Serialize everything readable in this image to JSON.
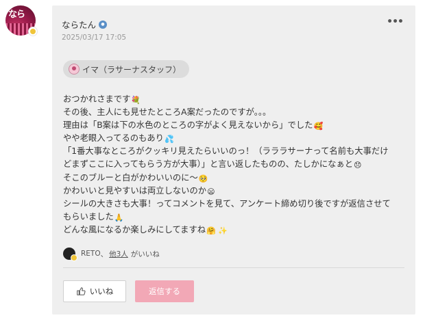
{
  "author": {
    "avatar_text": "なら",
    "name": "ならたん",
    "date": "2025/03/17 17:05"
  },
  "mention": {
    "label": "イマ（ラサーナスタッフ）"
  },
  "post_lines": [
    {
      "text": "おつかれさまです",
      "emoji": "💐"
    },
    {
      "text": "その後、主人にも見せたところA案だったのですが。。。",
      "emoji": ""
    },
    {
      "text": "理由は「B案は下の水色のところの字がよく見えないから」でした",
      "emoji": "🥰"
    },
    {
      "text": "やや老眼入ってるのもあり",
      "emoji": "💦"
    },
    {
      "text": "「1番大事なところがクッキリ見えたらいいのっ！（ラララサーナって名前も大事だけ",
      "emoji": ""
    },
    {
      "text": "どまずここに入ってもらう方が大事）」と言い返したものの、たしかになぁと",
      "emoji": "😞"
    },
    {
      "text": "そこのブルーと白がかわいいのに〜",
      "emoji": "🥺"
    },
    {
      "text": "かわいいと見やすいは両立しないのか",
      "emoji": "😦"
    },
    {
      "text": "シールの大きさも大事！ってコメントを見て、アンケート締め切り後ですが返信させて",
      "emoji": ""
    },
    {
      "text": "もらいました",
      "emoji": "🙏"
    },
    {
      "text": "どんな風になるか楽しみにしてますね",
      "emoji": "🤗 ✨"
    }
  ],
  "likes": {
    "name": "RETO",
    "separator": "、",
    "others": "他3人",
    "suffix": "がいいね"
  },
  "buttons": {
    "like": "いいね",
    "reply": "返信する"
  },
  "colors": {
    "card_bg": "#efefef",
    "reply_button": "#f2a8b6",
    "chip_bg": "#dcdcdc"
  }
}
